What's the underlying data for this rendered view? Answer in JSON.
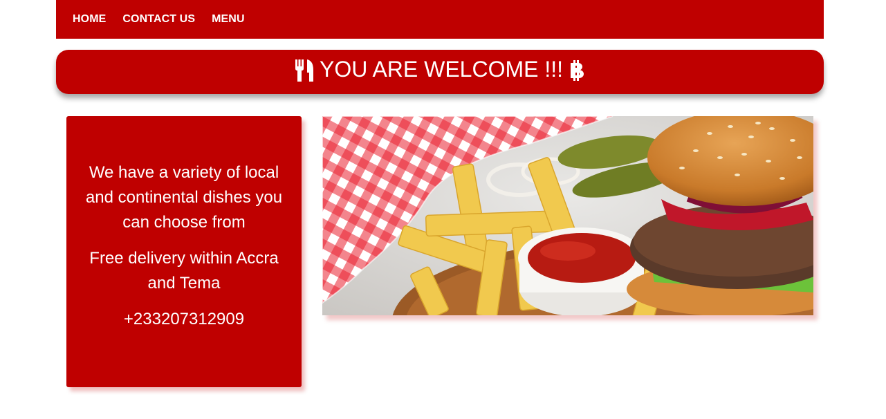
{
  "nav": {
    "items": [
      {
        "label": "HOME"
      },
      {
        "label": "CONTACT US"
      },
      {
        "label": "MENU"
      }
    ]
  },
  "banner": {
    "text": "YOU ARE WELCOME !!!",
    "left_icon": "utensils-icon",
    "right_icon": "bitcoin-icon"
  },
  "info": {
    "line1": "We have a variety of local and continental dishes you can choose from",
    "line2": "Free delivery within Accra and Tema",
    "phone": "+233207312909"
  },
  "hero": {
    "icon": "burger-and-fries-photo"
  },
  "colors": {
    "brand_red": "#bf0000",
    "text_light": "#ffffff"
  }
}
